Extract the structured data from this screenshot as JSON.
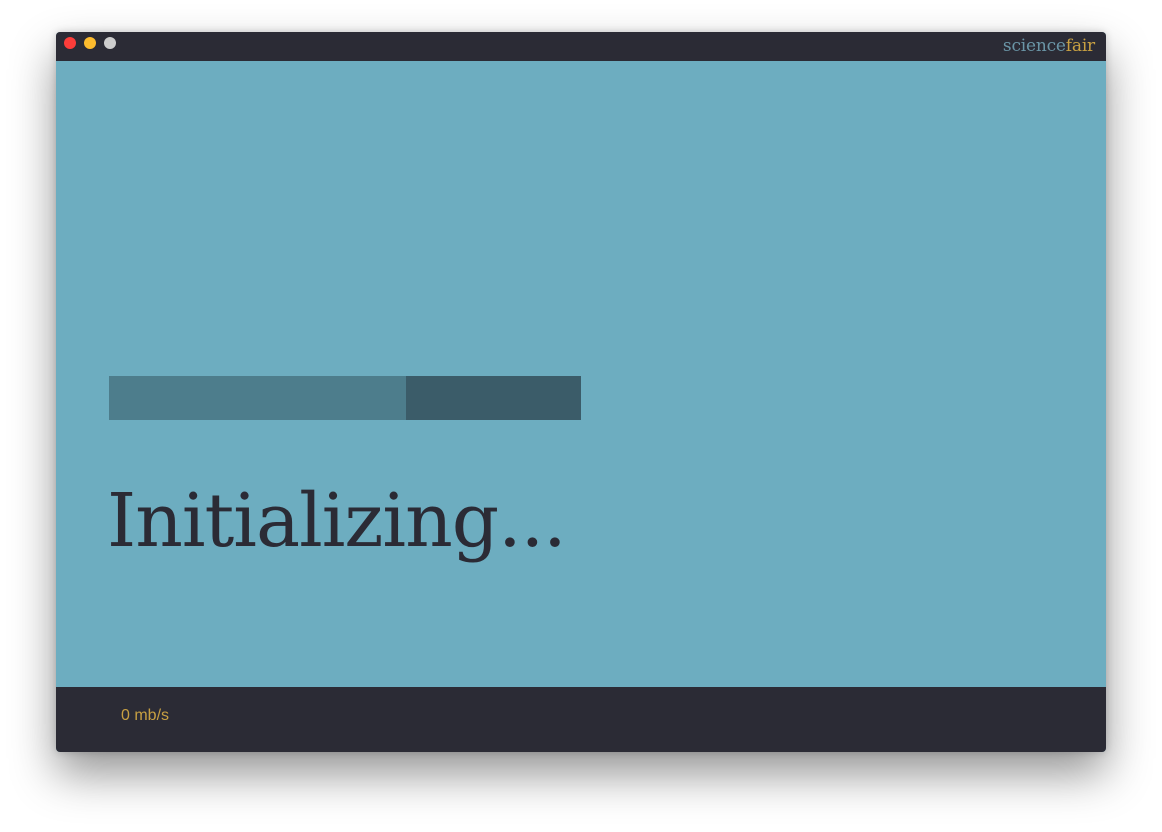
{
  "window": {
    "controls": {
      "close_icon": "close-icon",
      "minimize_icon": "minimize-icon",
      "maximize_icon": "maximize-icon"
    },
    "brand": {
      "part1": "science",
      "part2": "fair",
      "part1_color": "#6a95a6",
      "part2_color": "#c8a042"
    }
  },
  "main": {
    "progress_fraction": 0.63,
    "status": "Initializing...",
    "background_color": "#6dadc0"
  },
  "footer": {
    "speed": "0 mb/s",
    "speed_color": "#c8a042"
  }
}
